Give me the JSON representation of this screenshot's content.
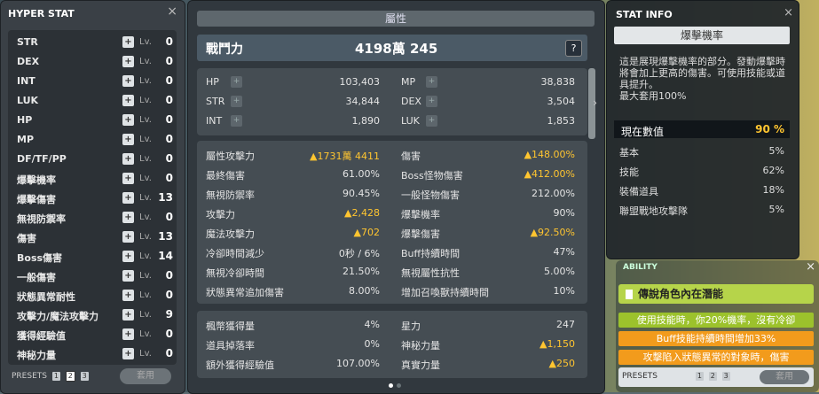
{
  "hyper_stat": {
    "title": "HYPER STAT",
    "close": "×",
    "lv_label": "Lv.",
    "plus": "+",
    "rows": [
      {
        "name": "STR",
        "level": "0"
      },
      {
        "name": "DEX",
        "level": "0"
      },
      {
        "name": "INT",
        "level": "0"
      },
      {
        "name": "LUK",
        "level": "0"
      },
      {
        "name": "HP",
        "level": "0"
      },
      {
        "name": "MP",
        "level": "0"
      },
      {
        "name": "DF/TF/PP",
        "level": "0"
      },
      {
        "name": "爆擊機率",
        "level": "0"
      },
      {
        "name": "爆擊傷害",
        "level": "13"
      },
      {
        "name": "無視防禦率",
        "level": "0"
      },
      {
        "name": "傷害",
        "level": "13"
      },
      {
        "name": "Boss傷害",
        "level": "14"
      },
      {
        "name": "一般傷害",
        "level": "0"
      },
      {
        "name": "狀態異常耐性",
        "level": "0"
      },
      {
        "name": "攻擊力/魔法攻擊力",
        "level": "9"
      },
      {
        "name": "獲得經驗值",
        "level": "0"
      },
      {
        "name": "神秘力量",
        "level": "0"
      }
    ],
    "presets_label": "PRESETS",
    "presets": [
      "1",
      "2",
      "3"
    ],
    "active_preset": "2",
    "apply_label": "套用"
  },
  "attributes": {
    "title": "屬性",
    "combat_power_label": "戰鬥力",
    "combat_power_value": "4198萬 245",
    "help": "?",
    "basic": [
      {
        "name": "HP",
        "value": "103,403"
      },
      {
        "name": "MP",
        "value": "38,838"
      },
      {
        "name": "STR",
        "value": "34,844"
      },
      {
        "name": "DEX",
        "value": "3,504"
      },
      {
        "name": "INT",
        "value": "1,890"
      },
      {
        "name": "LUK",
        "value": "1,853"
      }
    ],
    "detail": [
      {
        "name": "屬性攻擊力",
        "value": "▲1731萬 4411",
        "up": true
      },
      {
        "name": "傷害",
        "value": "▲148.00%",
        "up": true
      },
      {
        "name": "最終傷害",
        "value": "61.00%",
        "up": false
      },
      {
        "name": "Boss怪物傷害",
        "value": "▲412.00%",
        "up": true
      },
      {
        "name": "無視防禦率",
        "value": "90.45%",
        "up": false
      },
      {
        "name": "一般怪物傷害",
        "value": "212.00%",
        "up": false
      },
      {
        "name": "攻擊力",
        "value": "▲2,428",
        "up": true
      },
      {
        "name": "爆擊機率",
        "value": "90%",
        "up": false
      },
      {
        "name": "魔法攻擊力",
        "value": "▲702",
        "up": true
      },
      {
        "name": "爆擊傷害",
        "value": "▲92.50%",
        "up": true
      },
      {
        "name": "冷卻時間減少",
        "value": "0秒 / 6%",
        "up": false
      },
      {
        "name": "Buff持續時間",
        "value": "47%",
        "up": false
      },
      {
        "name": "無視冷卻時間",
        "value": "21.50%",
        "up": false
      },
      {
        "name": "無視屬性抗性",
        "value": "5.00%",
        "up": false
      },
      {
        "name": "狀態異常追加傷害",
        "value": "8.00%",
        "up": false
      },
      {
        "name": "增加召喚獸持續時間",
        "value": "10%",
        "up": false
      }
    ],
    "extra": [
      {
        "name": "楓幣獲得量",
        "value": "4%",
        "up": false
      },
      {
        "name": "星力",
        "value": "247",
        "up": false
      },
      {
        "name": "道具掉落率",
        "value": "0%",
        "up": false
      },
      {
        "name": "神秘力量",
        "value": "▲1,150",
        "up": true
      },
      {
        "name": "額外獲得經驗值",
        "value": "107.00%",
        "up": false
      },
      {
        "name": "真實力量",
        "value": "▲250",
        "up": true
      }
    ]
  },
  "stat_info": {
    "title": "STAT INFO",
    "close": "×",
    "subject": "爆擊機率",
    "description": "這是展現爆擊機率的部分。發動爆擊時將會加上更高的傷害。可使用技能或道具提升。",
    "max_applied": "最大套用100%",
    "current_label": "現在數值",
    "current_value": "90 %",
    "rows": [
      {
        "name": "基本",
        "value": "5%"
      },
      {
        "name": "技能",
        "value": "62%"
      },
      {
        "name": "裝備道具",
        "value": "18%"
      },
      {
        "name": "聯盟戰地攻擊隊",
        "value": "5%"
      }
    ]
  },
  "ability": {
    "title": "ABILITY",
    "close": "×",
    "grade": "傳說角色內在潛能",
    "lines": [
      {
        "text": "使用技能時，你20%機率，沒有冷卻",
        "color": "green"
      },
      {
        "text": "Buff技能持續時間增加33%",
        "color": "orange"
      },
      {
        "text": "攻擊陷入狀態異常的對象時，傷害",
        "color": "orange"
      }
    ],
    "presets_label": "PRESETS",
    "presets": [
      "1",
      "2",
      "3"
    ],
    "apply_label": "套用"
  }
}
